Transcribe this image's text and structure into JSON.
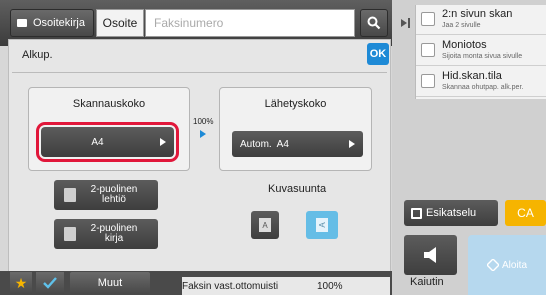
{
  "header": {
    "address_book_label": "Osoitekirja",
    "address_label": "Osoite",
    "fax_placeholder": "Faksinumero"
  },
  "panel": {
    "title": "Alkup.",
    "ok_label": "OK",
    "scan_size": {
      "title": "Skannauskoko",
      "value": "A4"
    },
    "ratio": "100%",
    "send_size": {
      "title": "Lähetyskoko",
      "value": "Autom.  A4"
    },
    "duplex_booklet": {
      "line1": "2-puolinen",
      "line2": "lehtiö"
    },
    "duplex_book": {
      "line1": "2-puolinen",
      "line2": "kirja"
    },
    "orientation": {
      "title": "Kuvasuunta",
      "portrait_glyph": "A",
      "landscape_glyph": "A"
    }
  },
  "bottom": {
    "more_label": "Muut",
    "memory_label": "Faksin vast.ottomuisti",
    "memory_value": "100%"
  },
  "side_menu": {
    "items": [
      {
        "label": "2:n sivun skan",
        "sub": "Jaa 2 sivulle"
      },
      {
        "label": "Moniotos",
        "sub": "Sijoita monta sivua sivulle"
      },
      {
        "label": "Hid.skan.tila",
        "sub": "Skannaa ohutpap. alk.per."
      }
    ]
  },
  "actions": {
    "preview_label": "Esikatselu",
    "ca_label": "CA",
    "speaker_label": "Kaiutin",
    "start_label": "Aloita"
  },
  "colors": {
    "accent_blue": "#1e8ad6",
    "highlight_red": "#e1173a",
    "ca_yellow": "#f6b400",
    "start_disabled": "#b6d8ee"
  }
}
